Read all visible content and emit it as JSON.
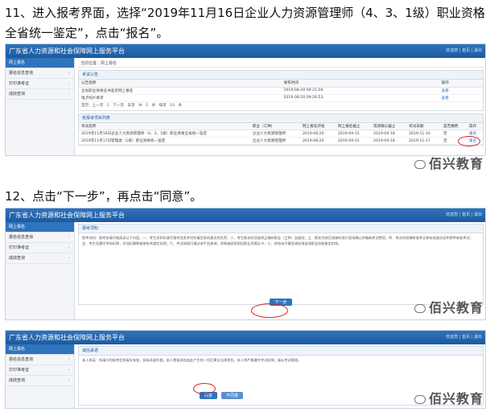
{
  "step1": "11、进入报考界面，选择“2019年11月16日企业人力资源管理师（4、3、1级）职业资格全省统一鉴定”，点击“报名”。",
  "step2": "12、点击“下一步”，再点击“同意”。",
  "portal_title": "广东省人力资源和社会保障网上服务平台",
  "top_right": "欢迎您 | 首页 | 退出",
  "sidebar": [
    "网上报名",
    "报名信息查询",
    "打印准考证",
    "成绩查询"
  ],
  "crumb": "当前位置：网上报名",
  "notice_panel": "考试公告",
  "notice_headers": [
    "公告名称",
    "发布时间",
    "操作"
  ],
  "notices": [
    [
      "全省职业资格证书鉴定网上报名",
      "2019-08-20 09:21:06",
      "查看"
    ],
    [
      "电子照片要求",
      "2019-08-20 09:26:53",
      "查看"
    ]
  ],
  "pager": "首页 上一页 1 下一页 末页 共 1 条 每页 10 条",
  "exam_panel": "有报考项目列表",
  "exam_headers": [
    "考试名称",
    "职业（工种）",
    "网上报名开始",
    "网上报名截止",
    "现场确认截止",
    "考试日期",
    "是否缴费",
    "操作"
  ],
  "exams": [
    [
      "2019年11月16日企业人力资源管理师（4、3、1级）职业资格全省统一鉴定",
      "企业人力资源管理师",
      "2019-08-20",
      "2019-09-15",
      "2019-09-18",
      "2019-11-16",
      "否",
      "报名"
    ],
    [
      "2019年11月17日管理类（1级）职业资格统一鉴定",
      "企业人力资源管理师",
      "2019-08-20",
      "2019-09-15",
      "2019-09-18",
      "2019-11-17",
      "否",
      "报名"
    ]
  ],
  "watermark": "佰兴教育",
  "agree_title": "报考须知",
  "agree_text": "报考须知：报考前请仔细阅读以下内容。一、考生须如实填写报考信息并对所填信息的真实性负责；二、考生报名时须选择正确的职业（工种）及级别；三、报名完成后请按时进行现场确认并缴纳考试费用；四、考试时须携带准考证和有效身份证件原件参加考试；五、考生须遵守考场纪律，对违纪舞弊者按有关规定处理；六、考试成绩可通过本平台查询，合格者颁发相应职业资格证书；七、其他未尽事宜请咨询当地职业技能鉴定机构。",
  "next_btn": "下一步",
  "confirm_title": "诚信承诺",
  "confirm_text": "本人承诺：所填写的报考信息真实有效，如有弄虚作假，本人愿意承担由此产生的一切后果及法律责任。本人将严格遵守考试纪律，服从考试管理。",
  "agree_btn": "同意",
  "disagree_btn": "不同意"
}
